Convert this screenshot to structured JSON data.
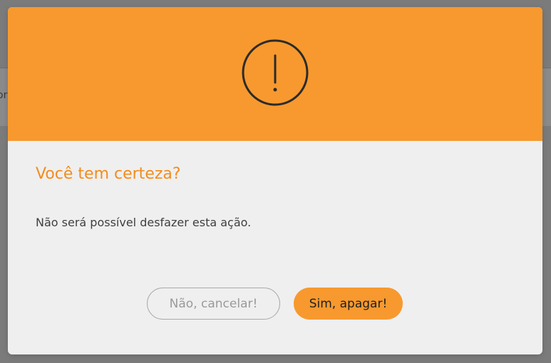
{
  "background": {
    "fragment_text": "or"
  },
  "modal": {
    "icon": "exclamation-circle-icon",
    "title": "Você tem certeza?",
    "message": "Não será possível desfazer esta ação.",
    "cancel_label": "Não, cancelar!",
    "confirm_label": "Sim, apagar!"
  },
  "colors": {
    "accent": "#f7992e",
    "title": "#f28c1e",
    "backdrop": "#7b7b7b",
    "modal_body": "#efefef"
  }
}
